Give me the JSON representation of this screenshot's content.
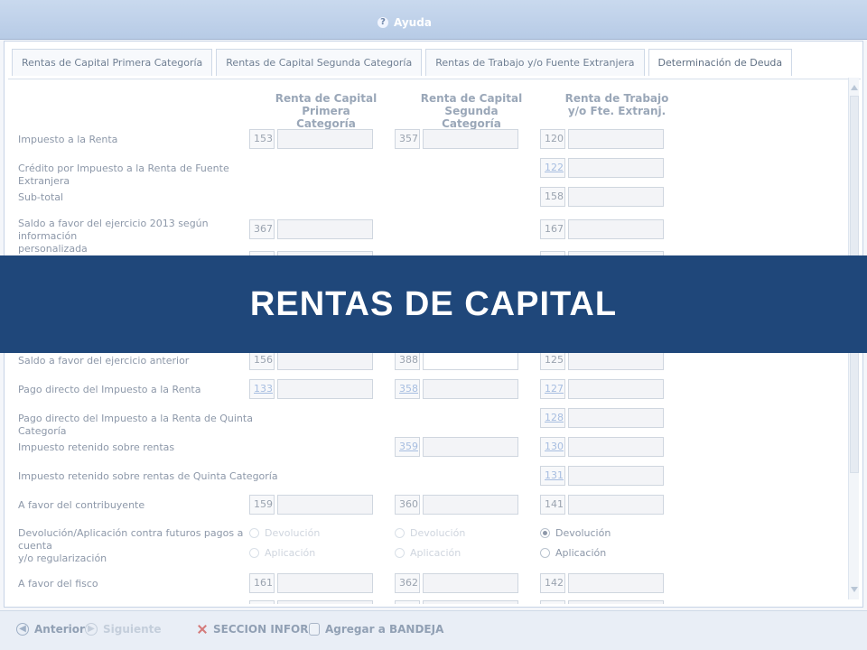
{
  "window": {
    "title": "Ayuda"
  },
  "tabs": [
    {
      "label": "Rentas de Capital Primera Categoría"
    },
    {
      "label": "Rentas de Capital Segunda Categoría"
    },
    {
      "label": "Rentas de Trabajo y/o Fuente Extranjera"
    },
    {
      "label": "Determinación de Deuda",
      "active": true
    }
  ],
  "columns": [
    {
      "line1": "Renta de Capital",
      "line2": "Primera Categoría"
    },
    {
      "line1": "Renta de Capital",
      "line2": "Segunda Categoría"
    },
    {
      "line1": "Renta de Trabajo",
      "line2": "y/o Fte. Extranj."
    }
  ],
  "rows": [
    {
      "label": "Impuesto a la Renta",
      "c1": "153",
      "c2": "357",
      "c3": "120"
    },
    {
      "label": "Crédito por Impuesto a la Renta de Fuente Extranjera",
      "c3": "122"
    },
    {
      "label": "Sub-total",
      "c3": "158"
    },
    {
      "label1": "Saldo a favor del ejercicio 2013 según información",
      "label2": "personalizada",
      "c1": "367",
      "c3": "167"
    },
    {
      "label": "Saldo a favor del ejercicio anterior",
      "c1": "156",
      "c2": "388",
      "c3": "125"
    },
    {
      "label": "Pago directo del Impuesto a la Renta",
      "c1": "133",
      "c2": "358",
      "c3": "127"
    },
    {
      "label": "Pago directo del Impuesto a la Renta de Quinta Categoría",
      "c3": "128"
    },
    {
      "label": "Impuesto retenido sobre rentas",
      "c2": "359",
      "c3": "130"
    },
    {
      "label": "Impuesto retenido sobre rentas de Quinta Categoría",
      "c3": "131"
    },
    {
      "label": "A favor del contribuyente",
      "c1": "159",
      "c2": "360",
      "c3": "141"
    },
    {
      "label1": "Devolución/Aplicación contra futuros pagos a cuenta",
      "label2": "y/o regularización",
      "opt1": "Devolución",
      "opt2": "Aplicación"
    },
    {
      "label": "A favor del fisco",
      "c1": "161",
      "c2": "362",
      "c3": "142"
    }
  ],
  "banner": {
    "text": "RENTAS   DE   CAPITAL"
  },
  "footer": {
    "prev": "Anterior",
    "next": "Siguiente",
    "seccion": "SECCION INFORM",
    "agregar": "Agregar a BANDEJA"
  },
  "colors": {
    "banner": "#1f477a",
    "link": "#a6bde0"
  }
}
